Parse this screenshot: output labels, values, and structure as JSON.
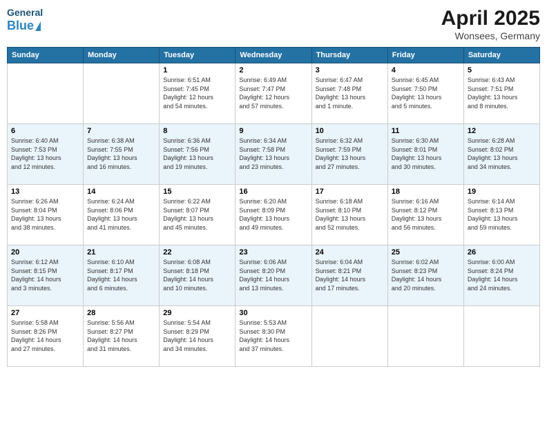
{
  "logo": {
    "general": "General",
    "blue": "Blue"
  },
  "header": {
    "month": "April 2025",
    "location": "Wonsees, Germany"
  },
  "days_of_week": [
    "Sunday",
    "Monday",
    "Tuesday",
    "Wednesday",
    "Thursday",
    "Friday",
    "Saturday"
  ],
  "weeks": [
    [
      {
        "day": "",
        "detail": ""
      },
      {
        "day": "",
        "detail": ""
      },
      {
        "day": "1",
        "detail": "Sunrise: 6:51 AM\nSunset: 7:45 PM\nDaylight: 12 hours\nand 54 minutes."
      },
      {
        "day": "2",
        "detail": "Sunrise: 6:49 AM\nSunset: 7:47 PM\nDaylight: 12 hours\nand 57 minutes."
      },
      {
        "day": "3",
        "detail": "Sunrise: 6:47 AM\nSunset: 7:48 PM\nDaylight: 13 hours\nand 1 minute."
      },
      {
        "day": "4",
        "detail": "Sunrise: 6:45 AM\nSunset: 7:50 PM\nDaylight: 13 hours\nand 5 minutes."
      },
      {
        "day": "5",
        "detail": "Sunrise: 6:43 AM\nSunset: 7:51 PM\nDaylight: 13 hours\nand 8 minutes."
      }
    ],
    [
      {
        "day": "6",
        "detail": "Sunrise: 6:40 AM\nSunset: 7:53 PM\nDaylight: 13 hours\nand 12 minutes."
      },
      {
        "day": "7",
        "detail": "Sunrise: 6:38 AM\nSunset: 7:55 PM\nDaylight: 13 hours\nand 16 minutes."
      },
      {
        "day": "8",
        "detail": "Sunrise: 6:36 AM\nSunset: 7:56 PM\nDaylight: 13 hours\nand 19 minutes."
      },
      {
        "day": "9",
        "detail": "Sunrise: 6:34 AM\nSunset: 7:58 PM\nDaylight: 13 hours\nand 23 minutes."
      },
      {
        "day": "10",
        "detail": "Sunrise: 6:32 AM\nSunset: 7:59 PM\nDaylight: 13 hours\nand 27 minutes."
      },
      {
        "day": "11",
        "detail": "Sunrise: 6:30 AM\nSunset: 8:01 PM\nDaylight: 13 hours\nand 30 minutes."
      },
      {
        "day": "12",
        "detail": "Sunrise: 6:28 AM\nSunset: 8:02 PM\nDaylight: 13 hours\nand 34 minutes."
      }
    ],
    [
      {
        "day": "13",
        "detail": "Sunrise: 6:26 AM\nSunset: 8:04 PM\nDaylight: 13 hours\nand 38 minutes."
      },
      {
        "day": "14",
        "detail": "Sunrise: 6:24 AM\nSunset: 8:06 PM\nDaylight: 13 hours\nand 41 minutes."
      },
      {
        "day": "15",
        "detail": "Sunrise: 6:22 AM\nSunset: 8:07 PM\nDaylight: 13 hours\nand 45 minutes."
      },
      {
        "day": "16",
        "detail": "Sunrise: 6:20 AM\nSunset: 8:09 PM\nDaylight: 13 hours\nand 49 minutes."
      },
      {
        "day": "17",
        "detail": "Sunrise: 6:18 AM\nSunset: 8:10 PM\nDaylight: 13 hours\nand 52 minutes."
      },
      {
        "day": "18",
        "detail": "Sunrise: 6:16 AM\nSunset: 8:12 PM\nDaylight: 13 hours\nand 56 minutes."
      },
      {
        "day": "19",
        "detail": "Sunrise: 6:14 AM\nSunset: 8:13 PM\nDaylight: 13 hours\nand 59 minutes."
      }
    ],
    [
      {
        "day": "20",
        "detail": "Sunrise: 6:12 AM\nSunset: 8:15 PM\nDaylight: 14 hours\nand 3 minutes."
      },
      {
        "day": "21",
        "detail": "Sunrise: 6:10 AM\nSunset: 8:17 PM\nDaylight: 14 hours\nand 6 minutes."
      },
      {
        "day": "22",
        "detail": "Sunrise: 6:08 AM\nSunset: 8:18 PM\nDaylight: 14 hours\nand 10 minutes."
      },
      {
        "day": "23",
        "detail": "Sunrise: 6:06 AM\nSunset: 8:20 PM\nDaylight: 14 hours\nand 13 minutes."
      },
      {
        "day": "24",
        "detail": "Sunrise: 6:04 AM\nSunset: 8:21 PM\nDaylight: 14 hours\nand 17 minutes."
      },
      {
        "day": "25",
        "detail": "Sunrise: 6:02 AM\nSunset: 8:23 PM\nDaylight: 14 hours\nand 20 minutes."
      },
      {
        "day": "26",
        "detail": "Sunrise: 6:00 AM\nSunset: 8:24 PM\nDaylight: 14 hours\nand 24 minutes."
      }
    ],
    [
      {
        "day": "27",
        "detail": "Sunrise: 5:58 AM\nSunset: 8:26 PM\nDaylight: 14 hours\nand 27 minutes."
      },
      {
        "day": "28",
        "detail": "Sunrise: 5:56 AM\nSunset: 8:27 PM\nDaylight: 14 hours\nand 31 minutes."
      },
      {
        "day": "29",
        "detail": "Sunrise: 5:54 AM\nSunset: 8:29 PM\nDaylight: 14 hours\nand 34 minutes."
      },
      {
        "day": "30",
        "detail": "Sunrise: 5:53 AM\nSunset: 8:30 PM\nDaylight: 14 hours\nand 37 minutes."
      },
      {
        "day": "",
        "detail": ""
      },
      {
        "day": "",
        "detail": ""
      },
      {
        "day": "",
        "detail": ""
      }
    ]
  ]
}
